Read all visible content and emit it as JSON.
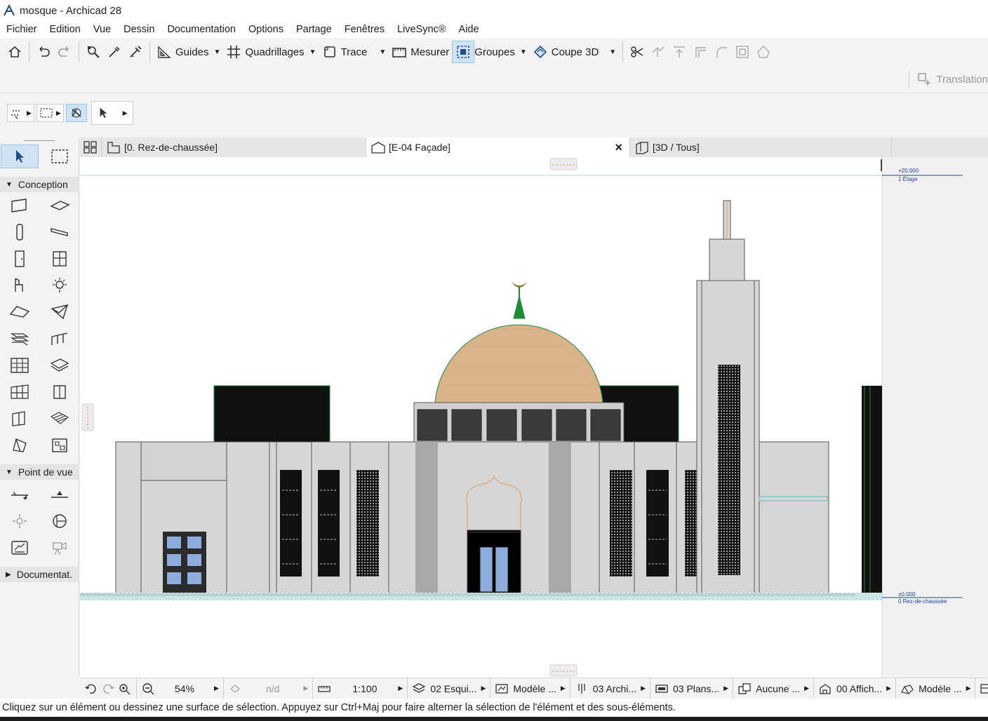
{
  "window": {
    "title": "mosque - Archicad 28"
  },
  "menu": [
    "Fichier",
    "Edition",
    "Vue",
    "Dessin",
    "Documentation",
    "Options",
    "Partage",
    "Fenêtres",
    "LiveSync®",
    "Aide"
  ],
  "toolbar": {
    "guides_label": "Guides",
    "grids_label": "Quadrillages",
    "trace_label": "Trace",
    "measure_label": "Mesurer",
    "groups_label": "Groupes",
    "section3d_label": "Coupe 3D",
    "translation_label": "Translation"
  },
  "toolbox": {
    "section_design": "Conception",
    "section_viewpoint": "Point de vue",
    "section_documentation": "Documentat."
  },
  "tabs": [
    {
      "label": "[0. Rez-de-chaussée]"
    },
    {
      "label": "[E-04 Façade]",
      "close": "×"
    },
    {
      "label": "[3D / Tous]"
    }
  ],
  "elevation": {
    "upper_level_value": "+20.000",
    "upper_level_name": "1 Étage",
    "ground_level_value": "±0.000",
    "ground_level_name": "0 Rez-de-chaussée",
    "colors": {
      "dome": "#d9b48a",
      "door_glass": "#8eacdc",
      "finial": "#1e8a3a",
      "wall": "#d6d6d6",
      "dark": "#111111"
    }
  },
  "statusbar": {
    "zoom": "54%",
    "angle": "n/d",
    "scale": "1:100",
    "layer_combo": "02 Esqui...",
    "model_view": "Modèle ...",
    "pen_set": "03 Archi...",
    "graphic_override": "03 Plans...",
    "renovation": "Aucune ...",
    "partial_display": "00 Affich...",
    "model_display": "Modèle ..."
  },
  "hint": "Cliquez sur un élément ou dessinez une surface de sélection. Appuyez sur Ctrl+Maj pour faire alterner la sélection de l'élément et des sous-éléments."
}
